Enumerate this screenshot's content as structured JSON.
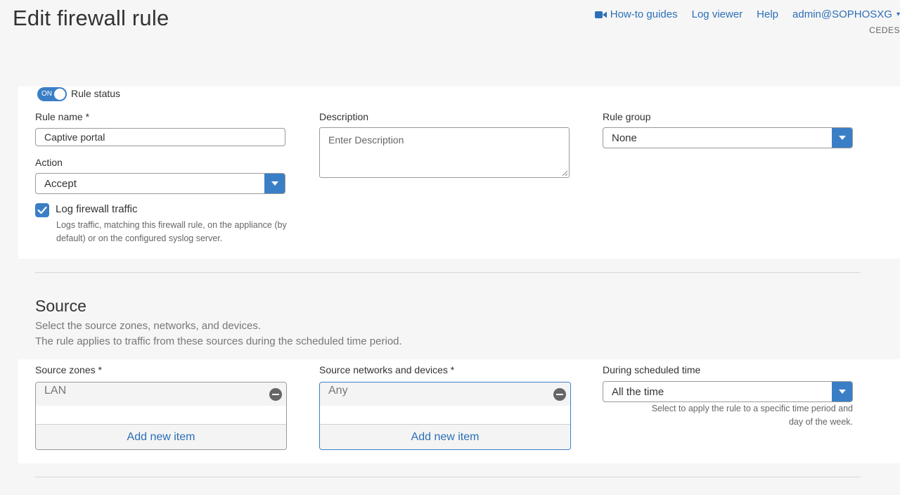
{
  "header": {
    "title": "Edit firewall rule",
    "nav": {
      "howto": "How-to guides",
      "logviewer": "Log viewer",
      "help": "Help",
      "user": "admin@SOPHOSXG"
    },
    "appliance_name": "CEDES"
  },
  "rule": {
    "status_toggle": "ON",
    "status_label": "Rule status",
    "name_label": "Rule name *",
    "name_value": "Captive portal",
    "description_label": "Description",
    "description_placeholder": "Enter Description",
    "group_label": "Rule group",
    "group_value": "None",
    "action_label": "Action",
    "action_value": "Accept",
    "log_label": "Log firewall traffic",
    "log_checked": true,
    "log_hint_line1": "Logs traffic, matching this firewall rule, on the appliance (by",
    "log_hint_line2": "default) or on the configured syslog server."
  },
  "source": {
    "title": "Source",
    "desc_line1": "Select the source zones, networks, and devices.",
    "desc_line2": "The rule applies to traffic from these sources during the scheduled time period.",
    "zones_label": "Source zones *",
    "zones_items": [
      "LAN"
    ],
    "zones_add": "Add new item",
    "networks_label": "Source networks and devices *",
    "networks_items": [
      "Any"
    ],
    "networks_add": "Add new item",
    "schedule_label": "During scheduled time",
    "schedule_value": "All the time",
    "schedule_hint_line1": "Select to apply the rule to a specific time period and",
    "schedule_hint_line2": "day of the week."
  },
  "colors": {
    "accent": "#3a7fc6",
    "link": "#2c6fb7"
  }
}
